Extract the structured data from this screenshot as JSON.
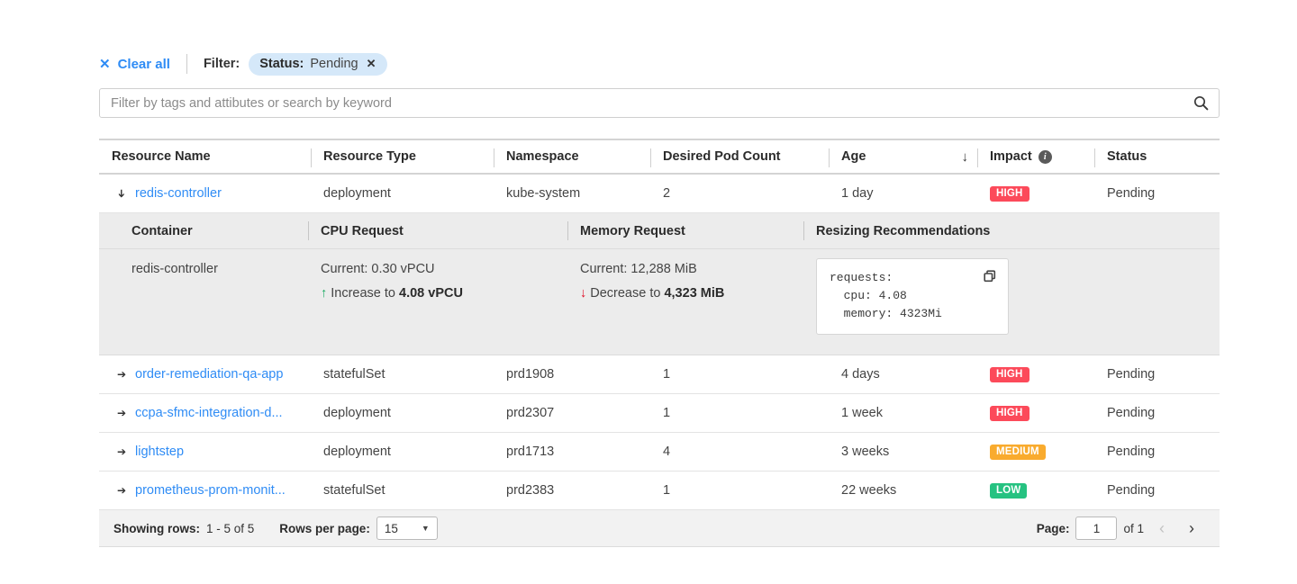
{
  "filter_bar": {
    "clear_all_label": "Clear all",
    "clear_all_icon": "close-icon",
    "filter_label": "Filter:",
    "chip": {
      "key": "Status:",
      "value": "Pending",
      "remove_icon": "close-icon"
    }
  },
  "search": {
    "placeholder": "Filter by tags and attibutes or search by keyword",
    "value": "",
    "icon": "search-icon"
  },
  "table": {
    "columns": [
      {
        "label": "Resource Name"
      },
      {
        "label": "Resource Type"
      },
      {
        "label": "Namespace"
      },
      {
        "label": "Desired Pod Count"
      },
      {
        "label": "Age",
        "sort_icon": "arrow-down-icon"
      },
      {
        "label": "Impact",
        "info_icon": "info-icon",
        "info_glyph": "i"
      },
      {
        "label": "Status"
      }
    ],
    "rows": [
      {
        "expanded": true,
        "chevron": "chevron-down-icon",
        "name": "redis-controller",
        "type": "deployment",
        "namespace": "kube-system",
        "pods": "2",
        "age": "1 day",
        "impact": "HIGH",
        "impact_level": "high",
        "status": "Pending"
      },
      {
        "expanded": false,
        "chevron": "chevron-right-icon",
        "name": "order-remediation-qa-app",
        "type": "statefulSet",
        "namespace": "prd1908",
        "pods": "1",
        "age": "4 days",
        "impact": "HIGH",
        "impact_level": "high",
        "status": "Pending"
      },
      {
        "expanded": false,
        "chevron": "chevron-right-icon",
        "name": "ccpa-sfmc-integration-d...",
        "type": "deployment",
        "namespace": "prd2307",
        "pods": "1",
        "age": "1 week",
        "impact": "HIGH",
        "impact_level": "high",
        "status": "Pending"
      },
      {
        "expanded": false,
        "chevron": "chevron-right-icon",
        "name": "lightstep",
        "type": "deployment",
        "namespace": "prd1713",
        "pods": "4",
        "age": "3 weeks",
        "impact": "MEDIUM",
        "impact_level": "medium",
        "status": "Pending"
      },
      {
        "expanded": false,
        "chevron": "chevron-right-icon",
        "name": "prometheus-prom-monit...",
        "type": "statefulSet",
        "namespace": "prd2383",
        "pods": "1",
        "age": "22 weeks",
        "impact": "LOW",
        "impact_level": "low",
        "status": "Pending"
      }
    ]
  },
  "detail": {
    "columns": {
      "container": "Container",
      "cpu_request": "CPU Request",
      "memory_request": "Memory Request",
      "recommendations": "Resizing Recommendations"
    },
    "container_name": "redis-controller",
    "cpu": {
      "current": "Current: 0.30 vPCU",
      "change_icon": "arrow-up-icon",
      "change_glyph": "↑",
      "change_prefix": "Increase to ",
      "change_value": "4.08 vPCU"
    },
    "memory": {
      "current": "Current: 12,288 MiB",
      "change_icon": "arrow-down-icon",
      "change_glyph": "↓",
      "change_prefix": "Decrease to ",
      "change_value": "4,323 MiB"
    },
    "code": "requests:\n  cpu: 4.08\n  memory: 4323Mi",
    "copy_icon": "copy-icon"
  },
  "footer": {
    "showing_rows_label": "Showing rows:",
    "showing_rows_value": "1 - 5 of 5",
    "rows_per_page_label": "Rows per page:",
    "rows_per_page_value": "15",
    "page_label": "Page:",
    "page_value": "1",
    "page_total": "of 1",
    "prev_icon": "chevron-left-icon",
    "next_icon": "chevron-right-icon"
  },
  "colors": {
    "link": "#2f8cf5",
    "high": "#fc4a5a",
    "medium": "#f9ab2e",
    "low": "#26c281",
    "increase": "#1aab62",
    "decrease": "#e0142c",
    "chip_bg": "#d5e8f9"
  }
}
